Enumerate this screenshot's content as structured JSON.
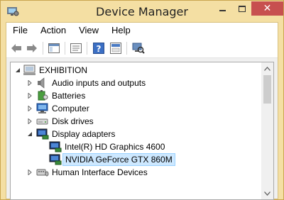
{
  "window": {
    "title": "Device Manager"
  },
  "menu": {
    "file": "File",
    "action": "Action",
    "view": "View",
    "help": "Help"
  },
  "toolbar": {
    "buttons": [
      "back-icon",
      "forward-icon",
      "show-hide-tree-icon",
      "properties-icon",
      "help-icon",
      "update-driver-icon",
      "scan-hardware-icon"
    ]
  },
  "tree": {
    "root": "EXHIBITION",
    "items": [
      {
        "label": "Audio inputs and outputs",
        "icon": "speaker-icon"
      },
      {
        "label": "Batteries",
        "icon": "battery-icon"
      },
      {
        "label": "Computer",
        "icon": "computer-icon"
      },
      {
        "label": "Disk drives",
        "icon": "disk-drive-icon"
      },
      {
        "label": "Display adapters",
        "icon": "display-adapter-icon"
      },
      {
        "label": "Intel(R) HD Graphics 4600",
        "icon": "display-adapter-icon"
      },
      {
        "label": "NVIDIA GeForce GTX 860M",
        "icon": "display-adapter-icon"
      },
      {
        "label": "Human Interface Devices",
        "icon": "hid-icon"
      }
    ]
  },
  "colors": {
    "frame": "#f4dfa3",
    "close": "#c7504f",
    "selection": "#cde8ff"
  }
}
